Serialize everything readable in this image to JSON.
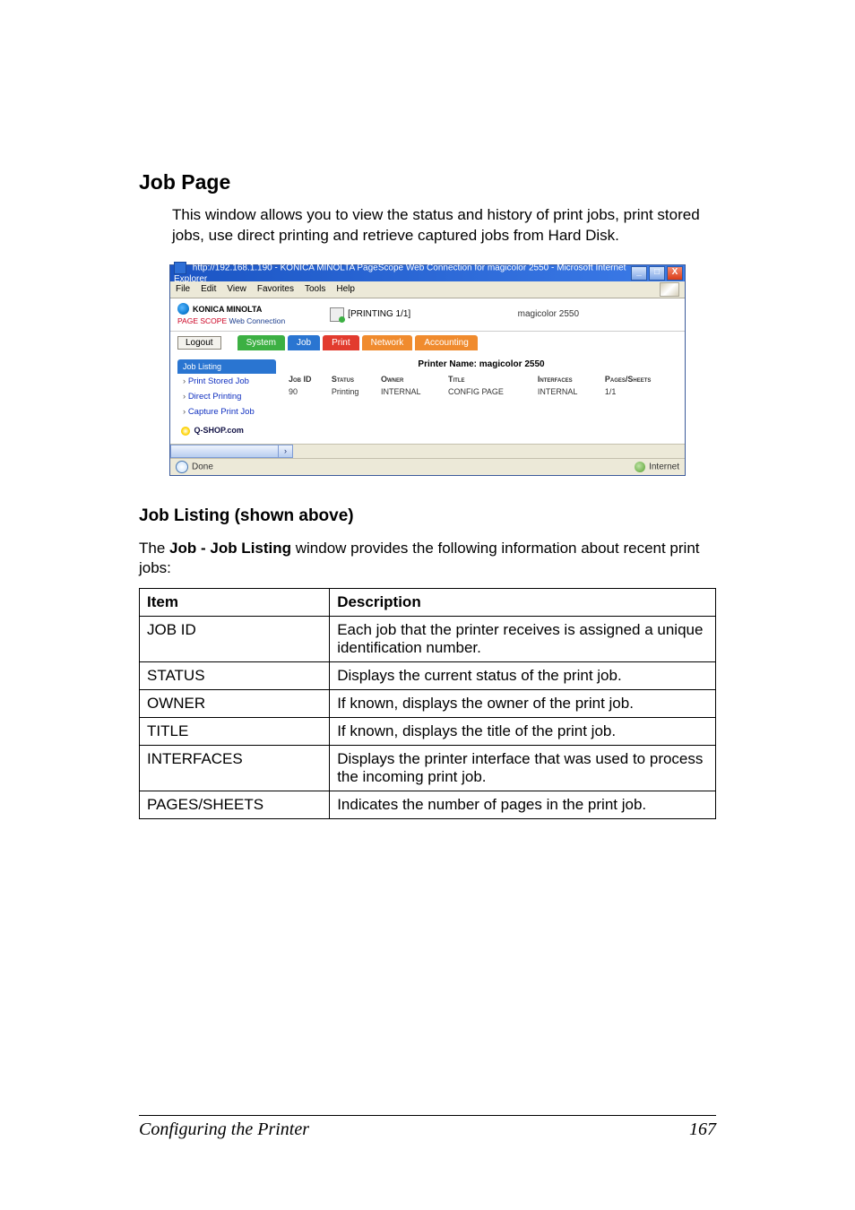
{
  "heading": "Job Page",
  "intro": "This window allows you to view the status and history of print jobs, print stored jobs, use direct printing and retrieve captured jobs from Hard Disk.",
  "screenshot": {
    "titlebar": "http://192.168.1.190 - KONICA MINOLTA PageScope Web Connection for magicolor 2550 - Microsoft Internet Explorer",
    "menu": {
      "file": "File",
      "edit": "Edit",
      "view": "View",
      "favorites": "Favorites",
      "tools": "Tools",
      "help": "Help"
    },
    "brand": "KONICA MINOLTA",
    "product": "Web Connection",
    "product_prefix": "PAGE SCOPE",
    "status": "[PRINTING 1/1]",
    "model": "magicolor 2550",
    "logout": "Logout",
    "tabs": {
      "system": "System",
      "job": "Job",
      "print": "Print",
      "network": "Network",
      "accounting": "Accounting"
    },
    "nav": {
      "head": "Job Listing",
      "items": [
        "Print Stored Job",
        "Direct Printing",
        "Capture Print Job"
      ]
    },
    "qshop": "Q-SHOP.com",
    "printer_name_label": "Printer Name: magicolor 2550",
    "table": {
      "headers": {
        "jobid": "Job ID",
        "status": "Status",
        "owner": "Owner",
        "title": "Title",
        "interfaces": "Interfaces",
        "pages": "Pages/Sheets"
      },
      "row": {
        "jobid": "90",
        "status": "Printing",
        "owner": "INTERNAL",
        "title": "CONFIG PAGE",
        "interfaces": "INTERNAL",
        "pages": "1/1"
      }
    },
    "statusbar": {
      "done": "Done",
      "zone": "Internet"
    }
  },
  "subhead": "Job Listing (shown above)",
  "listing_desc_prefix": "The ",
  "listing_desc_bold": "Job - Job Listing",
  "listing_desc_suffix": " window provides the following information about recent print jobs:",
  "table_headers": {
    "item": "Item",
    "description": "Description"
  },
  "rows": [
    {
      "item": "JOB ID",
      "desc": "Each job that the printer receives is assigned a unique identification number."
    },
    {
      "item": "STATUS",
      "desc": "Displays the current status of the print job."
    },
    {
      "item": "OWNER",
      "desc": "If known, displays the owner of the print job."
    },
    {
      "item": "TITLE",
      "desc": "If known, displays the title of the print job."
    },
    {
      "item": "INTERFACES",
      "desc": "Displays the printer interface that was used to process the incoming print job."
    },
    {
      "item": "PAGES/SHEETS",
      "desc": "Indicates the number of pages in the print job."
    }
  ],
  "footer": {
    "title": "Configuring the Printer",
    "page": "167"
  }
}
